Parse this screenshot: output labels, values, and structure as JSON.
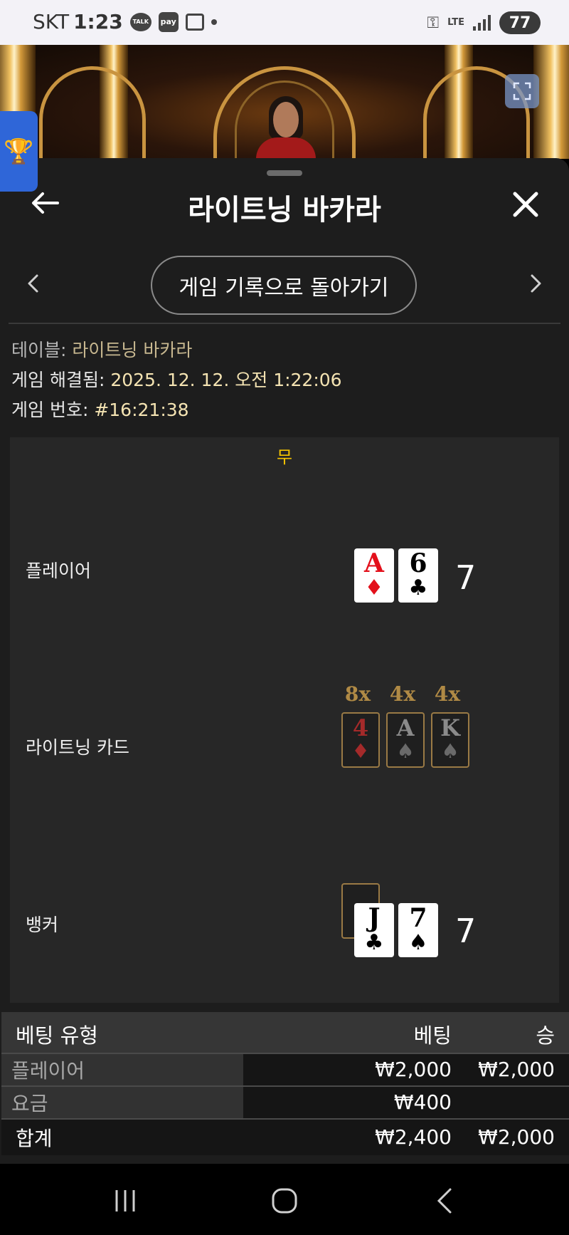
{
  "status_bar": {
    "carrier": "SKT",
    "time": "1:23",
    "talk_label": "TALK",
    "pay_label": "pay",
    "lte_label": "LTE",
    "battery": "77"
  },
  "header": {
    "title": "라이트닝 바카라"
  },
  "nav": {
    "back_to_history": "게임 기록으로 돌아가기"
  },
  "info": {
    "table_label": "테이블: ",
    "table_value": "라이트닝 바카라",
    "resolved_label": "게임 해결됨: ",
    "resolved_value": "2025. 12. 12. 오전 1:22:06",
    "number_label": "게임 번호: ",
    "number_value": "#16:21:38"
  },
  "result": {
    "outcome": "무",
    "player": {
      "label": "플레이어",
      "cards": [
        {
          "rank": "A",
          "suit": "♦",
          "color": "red"
        },
        {
          "rank": "6",
          "suit": "♣",
          "color": "black"
        }
      ],
      "total": "7"
    },
    "lightning": {
      "label": "라이트닝 카드",
      "cards": [
        {
          "mult": "8x",
          "rank": "4",
          "suit": "♦",
          "color": "red"
        },
        {
          "mult": "4x",
          "rank": "A",
          "suit": "♠",
          "color": "black"
        },
        {
          "mult": "4x",
          "rank": "K",
          "suit": "♠",
          "color": "black"
        }
      ]
    },
    "banker": {
      "label": "뱅커",
      "cards": [
        {
          "rank": "J",
          "suit": "♣",
          "color": "black"
        },
        {
          "rank": "7",
          "suit": "♠",
          "color": "black"
        }
      ],
      "total": "7"
    }
  },
  "bets": {
    "headers": {
      "type": "베팅 유형",
      "bet": "베팅",
      "win": "승"
    },
    "rows": [
      {
        "type": "플레이어",
        "bet": "₩2,000",
        "win": "₩2,000"
      },
      {
        "type": "요금",
        "bet": "₩400",
        "win": ""
      }
    ],
    "total": {
      "type": "합계",
      "bet": "₩2,400",
      "win": "₩2,000"
    }
  }
}
